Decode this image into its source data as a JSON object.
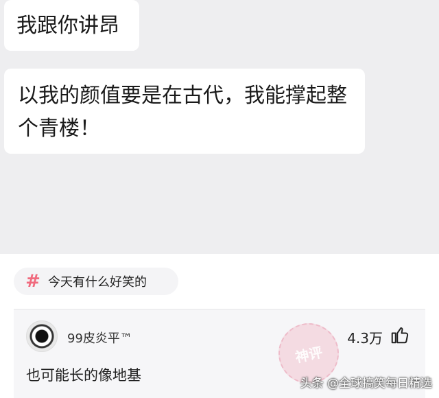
{
  "chat": {
    "messages": [
      {
        "text": "我跟你讲昂"
      },
      {
        "text": "以我的颜值要是在古代，我能撑起整个青楼！"
      }
    ]
  },
  "topic": {
    "icon": "hashtag-icon",
    "label": "今天有什么好笑的"
  },
  "comment": {
    "username": "99皮炎平™",
    "text": "也可能长的像地基",
    "likes": "4.3万",
    "stamp": "神评"
  },
  "watermark": "头条 @全球搞笑每日精选",
  "colors": {
    "accent": "#f06a7e",
    "chat_bg": "#eeeef0",
    "card_bg": "#f6f6f8"
  }
}
